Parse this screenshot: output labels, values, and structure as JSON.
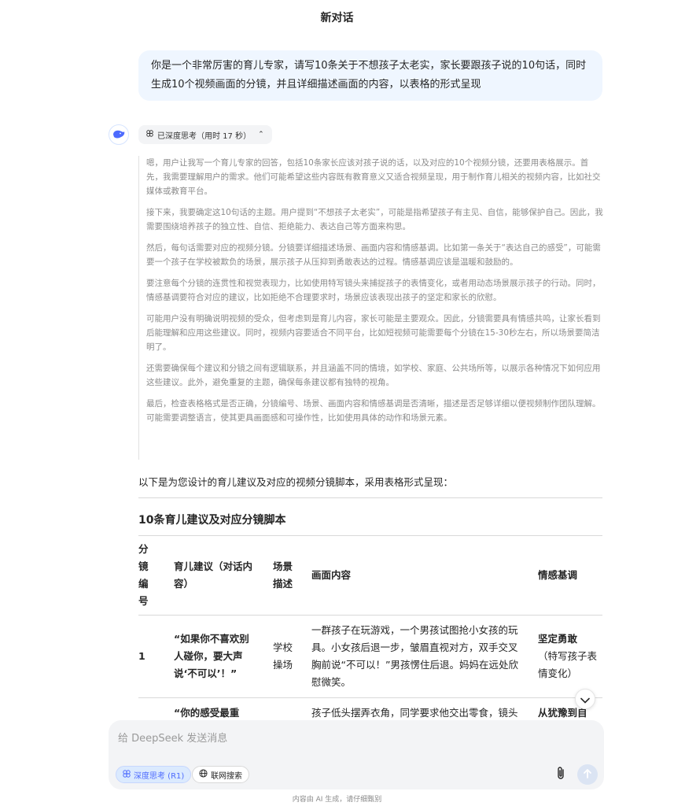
{
  "header": {
    "title": "新对话"
  },
  "user_message": "你是一个非常厉害的育儿专家，请写10条关于不想孩子太老实，家长要跟孩子说的10句话，同时生成10个视频画面的分镜，并且详细描述画面的内容，以表格的形式呈现",
  "thinking": {
    "chip_label": "已深度思考（用时 17 秒）",
    "paragraphs": [
      "嗯，用户让我写一个育儿专家的回答，包括10条家长应该对孩子说的话，以及对应的10个视频分镜，还要用表格展示。首先，我需要理解用户的需求。他们可能希望这些内容既有教育意义又适合视频呈现，用于制作育儿相关的视频内容，比如社交媒体或教育平台。",
      "接下来，我要确定这10句话的主题。用户提到“不想孩子太老实”，可能是指希望孩子有主见、自信，能够保护自己。因此，我需要围绕培养孩子的独立性、自信、拒绝能力、表达自己等方面来构思。",
      "然后，每句话需要对应的视频分镜。分镜要详细描述场景、画面内容和情感基调。比如第一条关于“表达自己的感受”，可能需要一个孩子在学校被欺负的场景，展示孩子从压抑到勇敢表达的过程。情感基调应该是温暖和鼓励的。",
      "要注意每个分镜的连贯性和视觉表现力，比如使用特写镜头来捕捉孩子的表情变化，或者用动态场景展示孩子的行动。同时，情感基调要符合对应的建议，比如拒绝不合理要求时，场景应该表现出孩子的坚定和家长的欣慰。",
      "可能用户没有明确说明视频的受众，但考虑到是育儿内容，家长可能是主要观众。因此，分镜需要具有情感共鸣，让家长看到后能理解和应用这些建议。同时，视频内容要适合不同平台，比如短视频可能需要每个分镜在15-30秒左右，所以场景要简洁明了。",
      "还需要确保每个建议和分镜之间有逻辑联系，并且涵盖不同的情境，如学校、家庭、公共场所等，以展示各种情况下如何应用这些建议。此外，避免重复的主题，确保每条建议都有独特的视角。",
      "最后，检查表格格式是否正确，分镜编号、场景、画面内容和情感基调是否清晰，描述是否足够详细以便视频制作团队理解。可能需要调整语言，使其更具画面感和可操作性，比如使用具体的动作和场景元素。"
    ]
  },
  "answer": {
    "intro": "以下是为您设计的育儿建议及对应的视频分镜脚本，采用表格形式呈现：",
    "table_title": "10条育儿建议及对应分镜脚本",
    "headers": {
      "num": "分镜编号",
      "advice": "育儿建议（对话内容）",
      "scene": "场景描述",
      "content": "画面内容",
      "emotion": "情感基调"
    },
    "rows": [
      {
        "num": "1",
        "advice": "“如果你不喜欢别人碰你，要大声说‘不可以’！”",
        "scene": "学校操场",
        "content": "一群孩子在玩游戏，一个男孩试图抢小女孩的玩具。小女孩后退一步，皱眉直视对方，双手交叉胸前说“不可以！”男孩愣住后退。妈妈在远处欣慰微笑。",
        "emotion": "坚定勇敢",
        "emotion_note": "（特写孩子表情变化）"
      },
      {
        "num": "",
        "advice": "“你的感受最重",
        "scene": "",
        "content": "孩子低头摆弄衣角，同学要求他交出零食，镜头",
        "emotion": "从犹豫到自",
        "emotion_note": ""
      }
    ]
  },
  "composer": {
    "placeholder": "给 DeepSeek 发送消息",
    "deep_think_label": "深度思考 (R1)",
    "web_search_label": "联网搜索"
  },
  "footer_note": "内容由 AI 生成，请仔细甄别",
  "colors": {
    "accent": "#4d6bfe",
    "user_bubble": "#eff6ff",
    "composer_bg": "#f3f4f6"
  }
}
